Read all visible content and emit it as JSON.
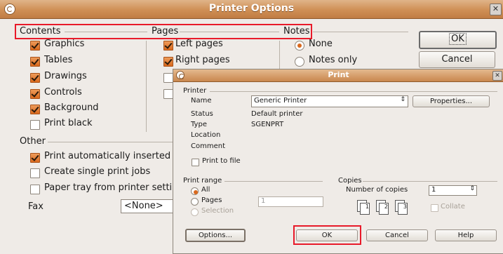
{
  "window": {
    "title": "Printer Options"
  },
  "sections": {
    "contents": "Contents",
    "pages": "Pages",
    "notes": "Notes",
    "other": "Other"
  },
  "contents_items": [
    {
      "label": "Graphics",
      "checked": true
    },
    {
      "label": "Tables",
      "checked": true
    },
    {
      "label": "Drawings",
      "checked": true
    },
    {
      "label": "Controls",
      "checked": true
    },
    {
      "label": "Background",
      "checked": true
    },
    {
      "label": "Print black",
      "checked": false
    }
  ],
  "pages_items": [
    {
      "label": "Left pages",
      "checked": true
    },
    {
      "label": "Right pages",
      "checked": true
    }
  ],
  "notes_items": [
    {
      "label": "None",
      "selected": true
    },
    {
      "label": "Notes only",
      "selected": false
    }
  ],
  "other_items": [
    {
      "label": "Print automatically inserted bla",
      "checked": true
    },
    {
      "label": "Create single print jobs",
      "checked": false
    },
    {
      "label": "Paper tray from printer settings",
      "checked": false
    }
  ],
  "fax": {
    "label": "Fax",
    "value": "<None>"
  },
  "buttons": {
    "ok": "OK",
    "cancel": "Cancel"
  },
  "print_dialog": {
    "title": "Print",
    "printer_section": "Printer",
    "name_label": "Name",
    "name_value": "Generic Printer",
    "properties_button": "Properties...",
    "status_label": "Status",
    "status_value": "Default printer",
    "type_label": "Type",
    "type_value": "SGENPRT",
    "location_label": "Location",
    "comment_label": "Comment",
    "print_to_file": "Print to file",
    "print_range_section": "Print range",
    "range_all": "All",
    "range_pages": "Pages",
    "pages_value": "1",
    "range_selection": "Selection",
    "copies_section": "Copies",
    "number_of_copies_label": "Number of copies",
    "copies_value": "1",
    "collate": "Collate",
    "copy_icon_numbers": [
      "1",
      "2",
      "3"
    ],
    "options_button": "Options...",
    "ok_button": "OK",
    "cancel_button": "Cancel",
    "help_button": "Help"
  },
  "colors": {
    "titlebar": "#cf8f55",
    "highlight": "#e81a2a",
    "check": "#d9691d"
  }
}
